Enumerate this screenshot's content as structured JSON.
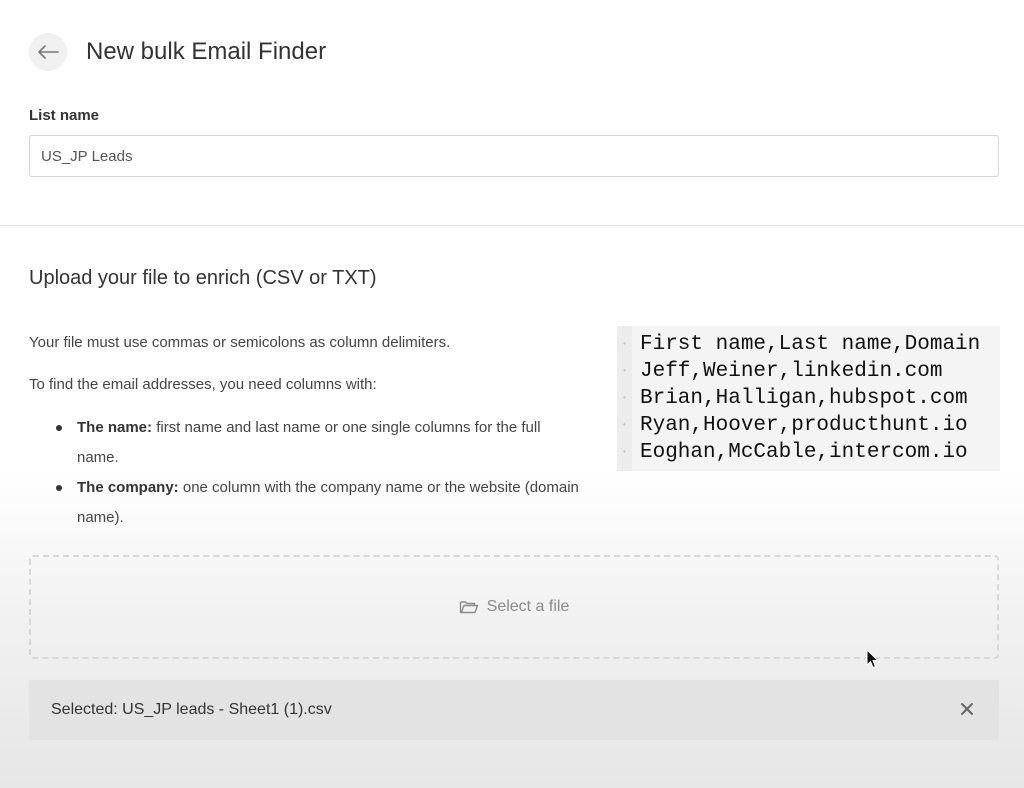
{
  "header": {
    "title": "New bulk Email Finder",
    "back_icon": "arrow-left-icon"
  },
  "list_name": {
    "label": "List name",
    "value": "US_JP Leads"
  },
  "upload": {
    "title": "Upload your file to enrich (CSV or TXT)",
    "delimiter_note": "Your file must use commas or semicolons as column delimiters.",
    "columns_intro": "To find the email addresses, you need columns with:",
    "requirements": [
      {
        "term": "The name:",
        "text": "first name and last name or one single columns for the full name."
      },
      {
        "term": "The company:",
        "text": "one column with the company name or the website (domain name)."
      }
    ],
    "sample_lines": [
      "First name,Last name,Domain",
      "Jeff,Weiner,linkedin.com",
      "Brian,Halligan,hubspot.com",
      "Ryan,Hoover,producthunt.io",
      "Eoghan,McCable,intercom.io"
    ]
  },
  "dropzone": {
    "icon": "folder-open-icon",
    "label": "Select a file"
  },
  "selected_file": {
    "text": "Selected: US_JP leads - Sheet1 (1).csv",
    "close_icon": "close-icon"
  },
  "colors": {
    "text_primary": "#333333",
    "text_muted": "#8a8a8a",
    "border": "#d6d6d6",
    "selected_bg": "#e3e3e3"
  }
}
